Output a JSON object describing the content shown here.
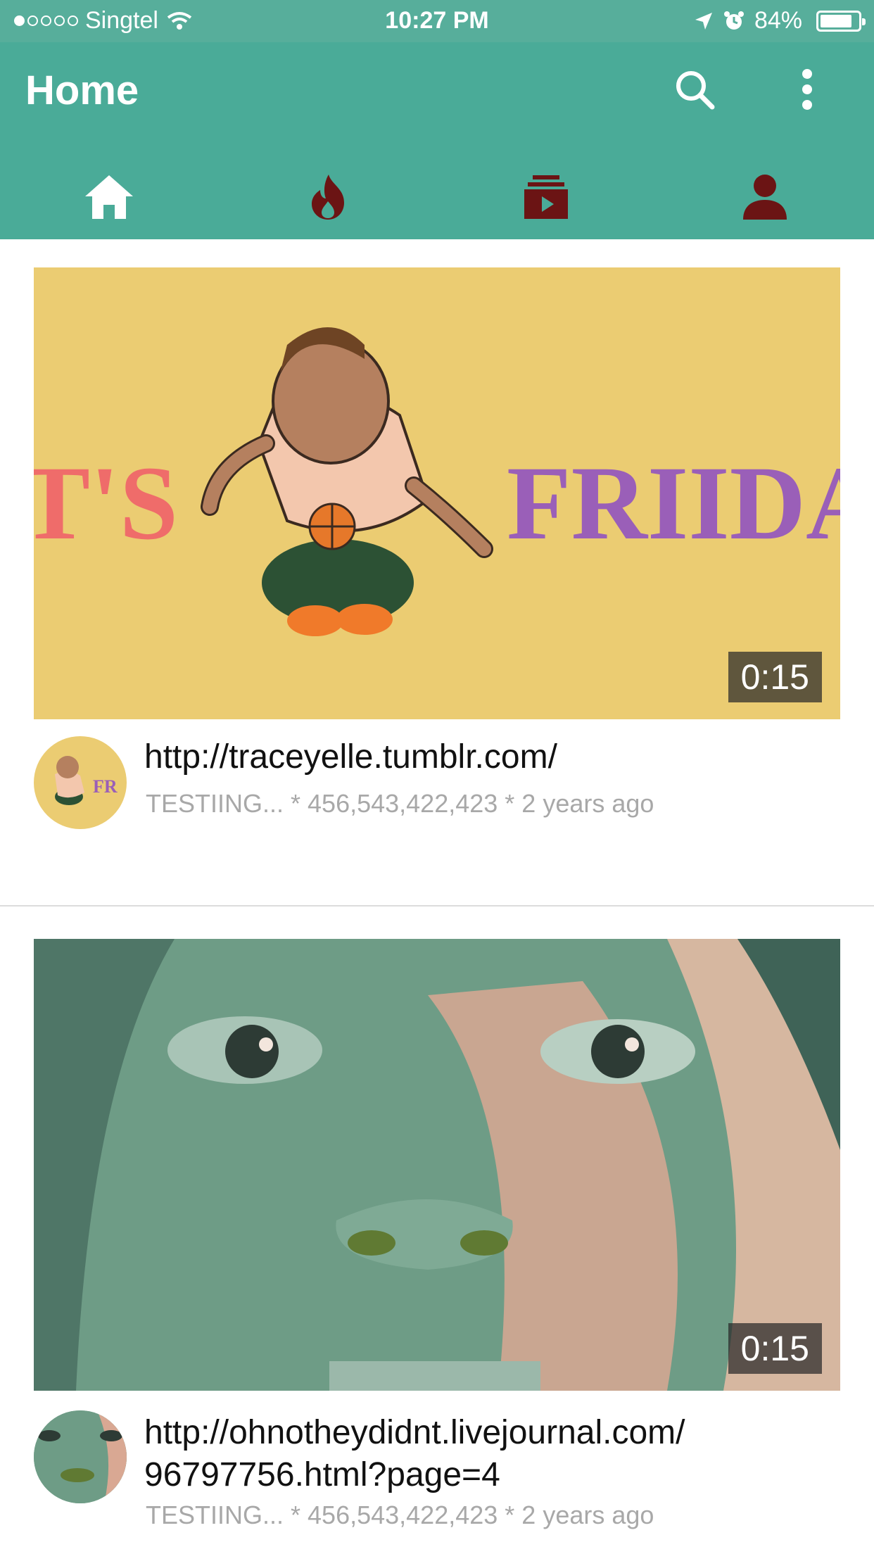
{
  "status_bar": {
    "carrier": "Singtel",
    "time": "10:27 PM",
    "battery": "84%",
    "battery_level": 0.84,
    "signal_dots_filled": 1,
    "signal_dots_total": 5
  },
  "header": {
    "title": "Home",
    "bg_color": "#4aab98",
    "accent_dark": "#6b1414",
    "icons": [
      "search-icon",
      "more-vert-icon"
    ]
  },
  "tabs": [
    {
      "name": "home",
      "icon": "home-icon",
      "active": true
    },
    {
      "name": "trending",
      "icon": "flame-icon",
      "active": false
    },
    {
      "name": "subscriptions",
      "icon": "subscriptions-icon",
      "active": false
    },
    {
      "name": "account",
      "icon": "person-icon",
      "active": false
    }
  ],
  "feed": [
    {
      "duration": "0:15",
      "title": "http://traceyelle.tumblr.com/",
      "meta": "TESTIING... * 456,543,422,423 * 2 years ago",
      "thumb_text_left": "T'S",
      "thumb_text_right": "FRIIDA"
    },
    {
      "duration": "0:15",
      "title": "http://ohnotheydidnt.livejournal.com/ 96797756.html?page=4",
      "meta": "TESTIING... * 456,543,422,423 * 2 years ago"
    }
  ]
}
